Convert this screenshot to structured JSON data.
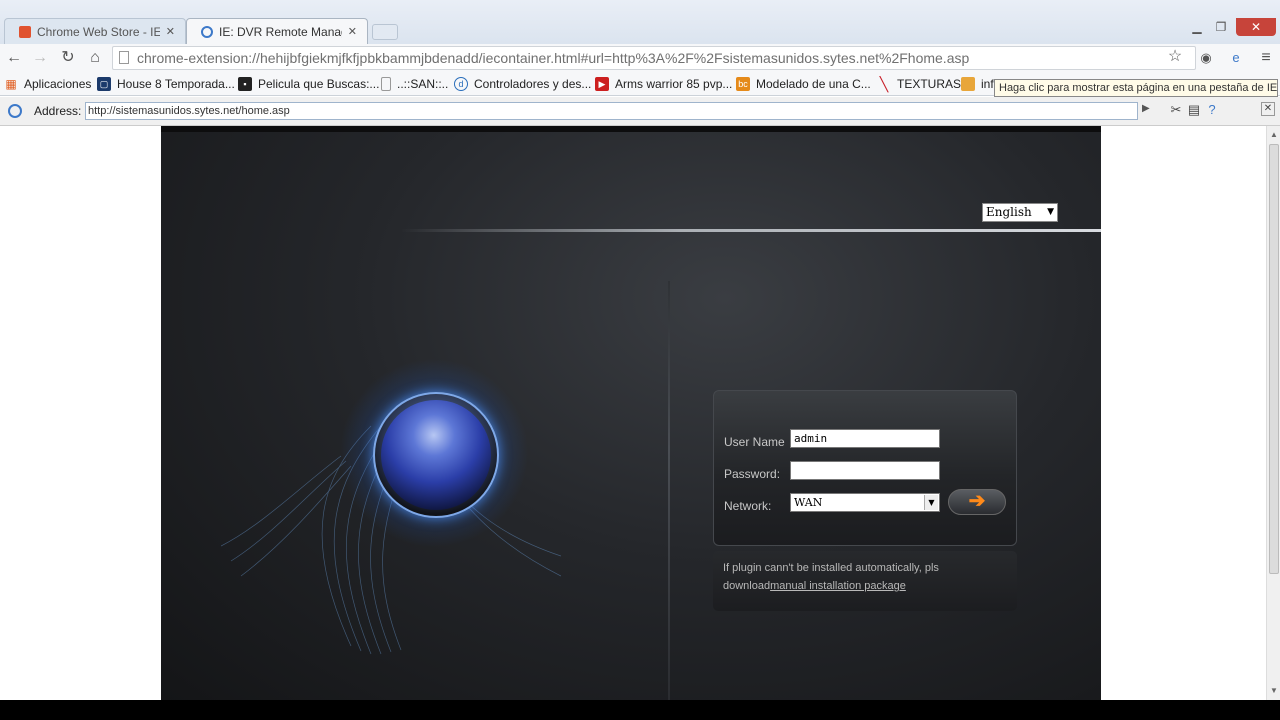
{
  "tabs": [
    {
      "label": "Chrome Web Store - IE Tab",
      "icon": "chrome-store-icon"
    },
    {
      "label": "IE: DVR Remote Managem",
      "icon": "ie-icon"
    }
  ],
  "toolbar": {
    "url": "chrome-extension://hehijbfgiekmjfkfjpbkbammjbdenadd/iecontainer.html#url=http%3A%2F%2Fsistemasunidos.sytes.net%2Fhome.asp"
  },
  "bookmarks": [
    {
      "label": "Aplicaciones",
      "icon": "apps-grid-icon",
      "color": "#e05a1c"
    },
    {
      "label": "House 8 Temporada...",
      "icon": "tv-icon",
      "color": "#1b3a6b"
    },
    {
      "label": "Pelicula que Buscas:...",
      "icon": "film-icon",
      "color": "#222222"
    },
    {
      "label": "..::SAN::..",
      "icon": "page-icon",
      "color": "#888888"
    },
    {
      "label": "Controladores y des...",
      "icon": "dell-icon",
      "color": "#2a6ebb"
    },
    {
      "label": "Arms warrior 85 pvp...",
      "icon": "youtube-icon",
      "color": "#cc1f1f"
    },
    {
      "label": "Modelado de una C...",
      "icon": "bc-icon",
      "color": "#e58a1a"
    },
    {
      "label": "TEXTURAS",
      "icon": "texturas-icon",
      "color": "#c8202a"
    },
    {
      "label": "inf",
      "icon": "folder-icon",
      "color": "#e8a63a"
    }
  ],
  "tooltip": "Haga clic para mostrar esta página en una pestaña de IE",
  "iebar": {
    "address_label": "Address:",
    "address_value": "http://sistemasunidos.sytes.net/home.asp"
  },
  "dvr": {
    "language": "English",
    "user_label": "User Name",
    "user_value": "admin",
    "password_label": "Password:",
    "network_label": "Network:",
    "network_value": "WAN",
    "login_arrow": "➔",
    "plugin_text": "If plugin cann't be installed automatically, pls download",
    "plugin_link": "manual installation package"
  },
  "colors": {
    "accent_orange": "#ff8a1a",
    "lens_blue": "#2b3ea8"
  }
}
